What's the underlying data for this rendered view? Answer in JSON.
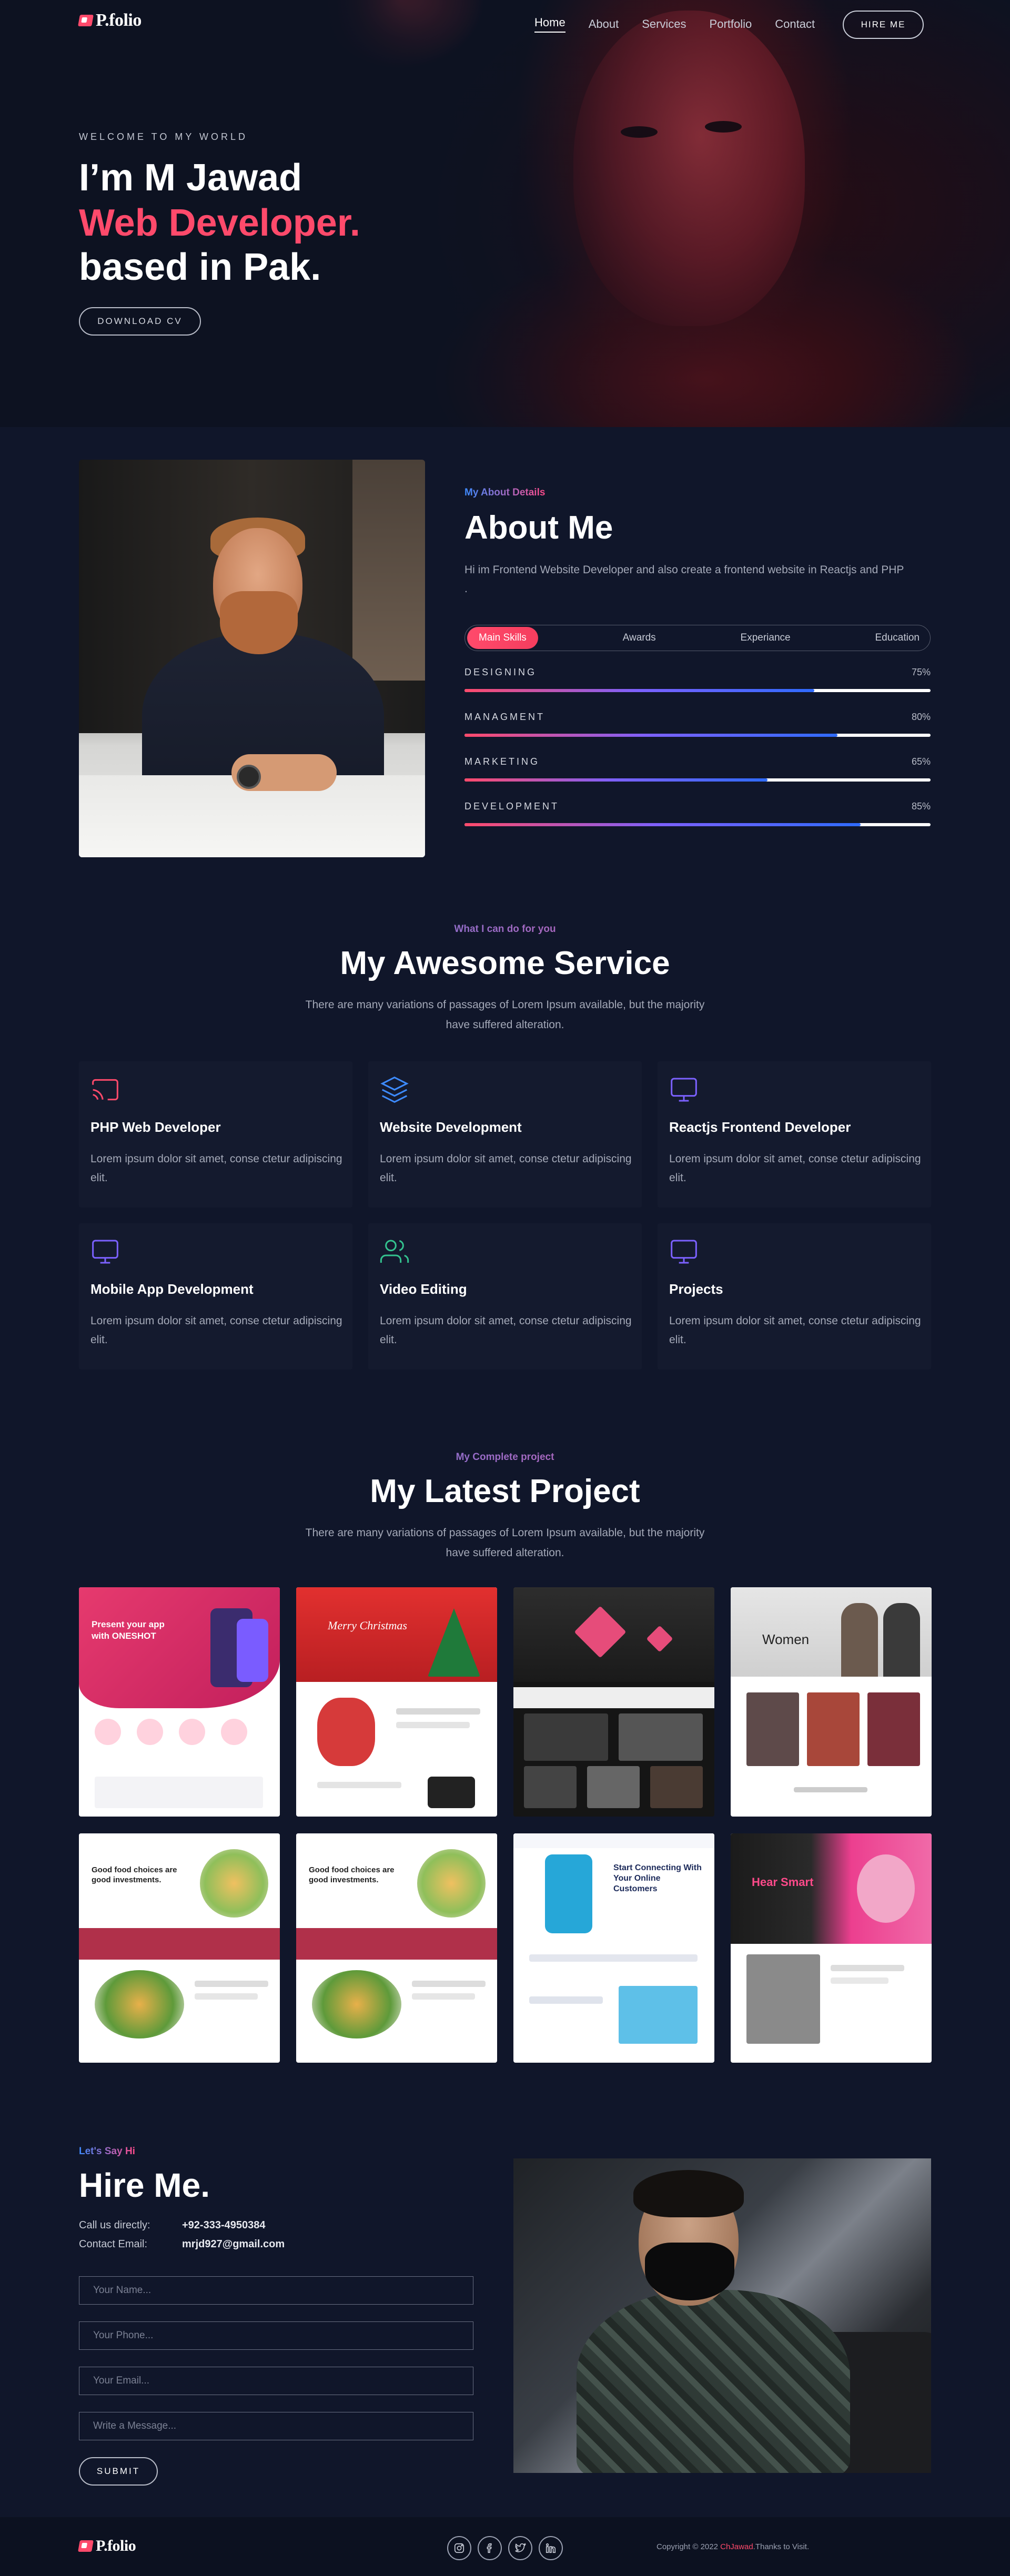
{
  "brand": {
    "logo_text": "P.folio",
    "accent_color": "#ff4a6b"
  },
  "nav": {
    "items": [
      {
        "label": "Home",
        "active": true
      },
      {
        "label": "About",
        "active": false
      },
      {
        "label": "Services",
        "active": false
      },
      {
        "label": "Portfolio",
        "active": false
      },
      {
        "label": "Contact",
        "active": false
      }
    ],
    "hire_label": "HIRE ME"
  },
  "hero": {
    "welcome": "WELCOME TO MY WORLD",
    "line1": "I’m M Jawad",
    "line2": "Web Developer.",
    "line3": "based in Pak.",
    "cv_label": "DOWNLOAD CV"
  },
  "about": {
    "kicker": "My About Details",
    "title": "About Me",
    "description": "Hi im Frontend Website Developer and also create a frontend website in Reactjs and PHP .",
    "tabs": [
      {
        "label": "Main Skills",
        "active": true
      },
      {
        "label": "Awards",
        "active": false
      },
      {
        "label": "Experiance",
        "active": false
      },
      {
        "label": "Education",
        "active": false
      }
    ],
    "skills": [
      {
        "name": "DESIGNING",
        "percent_label": "75%",
        "value": 75
      },
      {
        "name": "MANAGMENT",
        "percent_label": "80%",
        "value": 80
      },
      {
        "name": "MARKETING",
        "percent_label": "65%",
        "value": 65
      },
      {
        "name": "DEVELOPMENT",
        "percent_label": "85%",
        "value": 85
      }
    ]
  },
  "services": {
    "kicker": "What I can do for you",
    "title": "My Awesome Service",
    "description": "There are many variations of passages of Lorem Ipsum available, but the majority have suffered alteration.",
    "items": [
      {
        "icon": "cast-icon",
        "icon_color": "#ff4a6b",
        "title": "PHP Web Developer",
        "text": "Lorem ipsum dolor sit amet, conse ctetur adipiscing elit."
      },
      {
        "icon": "layers-icon",
        "icon_color": "#3d8bff",
        "title": "Website Development",
        "text": "Lorem ipsum dolor sit amet, conse ctetur adipiscing elit."
      },
      {
        "icon": "monitor-icon",
        "icon_color": "#7b61ff",
        "title": "Reactjs Frontend Developer",
        "text": "Lorem ipsum dolor sit amet, conse ctetur adipiscing elit."
      },
      {
        "icon": "monitor-icon",
        "icon_color": "#7b61ff",
        "title": "Mobile App Development",
        "text": "Lorem ipsum dolor sit amet, conse ctetur adipiscing elit."
      },
      {
        "icon": "users-icon",
        "icon_color": "#34c38f",
        "title": "Video Editing",
        "text": "Lorem ipsum dolor sit amet, conse ctetur adipiscing elit."
      },
      {
        "icon": "monitor-icon",
        "icon_color": "#7b61ff",
        "title": "Projects",
        "text": "Lorem ipsum dolor sit amet, conse ctetur adipiscing elit."
      }
    ]
  },
  "projects": {
    "kicker": "My Complete project",
    "title": "My Latest Project",
    "description": "There are many variations of passages of Lorem Ipsum available, but the majority have suffered alteration.",
    "items": [
      {
        "headline": "Present your app with ONESHOT",
        "theme": "#e0306b"
      },
      {
        "headline": "Merry Christmas",
        "theme": "#d62d2d"
      },
      {
        "headline": "",
        "theme": "#1a1a1a"
      },
      {
        "headline": "Women",
        "theme": "#d9d9d9"
      },
      {
        "headline": "Good food choices are good investments.",
        "theme": "#b0304a"
      },
      {
        "headline": "Good food choices are good investments.",
        "theme": "#b0304a"
      },
      {
        "headline": "Start Connecting With Your Online Customers",
        "theme": "#1c2a5a"
      },
      {
        "headline": "Hear Smart",
        "theme": "#ec3f8f"
      }
    ]
  },
  "hire": {
    "kicker": "Let's Say Hi",
    "title": "Hire Me.",
    "phone_label": "Call us directly:",
    "phone_value": "+92-333-4950384",
    "email_label": "Contact Email:",
    "email_value": "mrjd927@gmail.com",
    "name_placeholder": "Your Name...",
    "phone_placeholder": "Your Phone...",
    "email_placeholder": "Your Email...",
    "message_placeholder": "Write a Message...",
    "submit_label": "SUBMIT"
  },
  "footer": {
    "logo_text": "P.folio",
    "social": [
      "instagram-icon",
      "facebook-icon",
      "twitter-icon",
      "linkedin-icon"
    ],
    "copyright_prefix": "Copyright © 2022 ",
    "copyright_name": "ChJawad",
    "copyright_suffix": ".Thanks to Visit."
  }
}
